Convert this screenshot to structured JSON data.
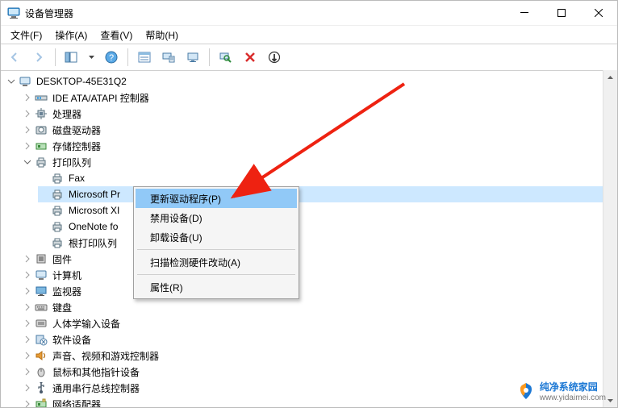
{
  "window": {
    "title": "设备管理器"
  },
  "menubar": {
    "file": "文件(F)",
    "action": "操作(A)",
    "view": "查看(V)",
    "help": "帮助(H)"
  },
  "toolbar_icons": {
    "back": "back-icon",
    "forward": "forward-icon",
    "showhide": "show-hide-console-tree-icon",
    "help": "help-icon",
    "details": "details-pane-icon",
    "monitor_sheet": "devices-by-type-icon",
    "monitor": "devices-by-connection-icon",
    "scan": "scan-hardware-icon",
    "remove": "uninstall-device-icon",
    "refresh": "update-driver-icon"
  },
  "tree": {
    "root": "DESKTOP-45E31Q2",
    "ide": "IDE ATA/ATAPI 控制器",
    "cpu": "处理器",
    "disk": "磁盘驱动器",
    "storage": "存储控制器",
    "printq": "打印队列",
    "printq_children": {
      "fax": "Fax",
      "msprint": "Microsoft Pr",
      "msxps": "Microsoft XI",
      "onenote": "OneNote fo",
      "rootqueue": "根打印队列"
    },
    "firmware": "固件",
    "computer": "计算机",
    "monitor": "监视器",
    "keyboard": "键盘",
    "hid": "人体学输入设备",
    "software": "软件设备",
    "sound": "声音、视频和游戏控制器",
    "mouse": "鼠标和其他指针设备",
    "usb": "通用串行总线控制器",
    "network": "网络适配器"
  },
  "context_menu": {
    "update": "更新驱动程序(P)",
    "disable": "禁用设备(D)",
    "uninstall": "卸载设备(U)",
    "scan": "扫描检测硬件改动(A)",
    "properties": "属性(R)"
  },
  "watermark": {
    "name": "纯净系统家园",
    "url": "www.yidaimei.com"
  }
}
